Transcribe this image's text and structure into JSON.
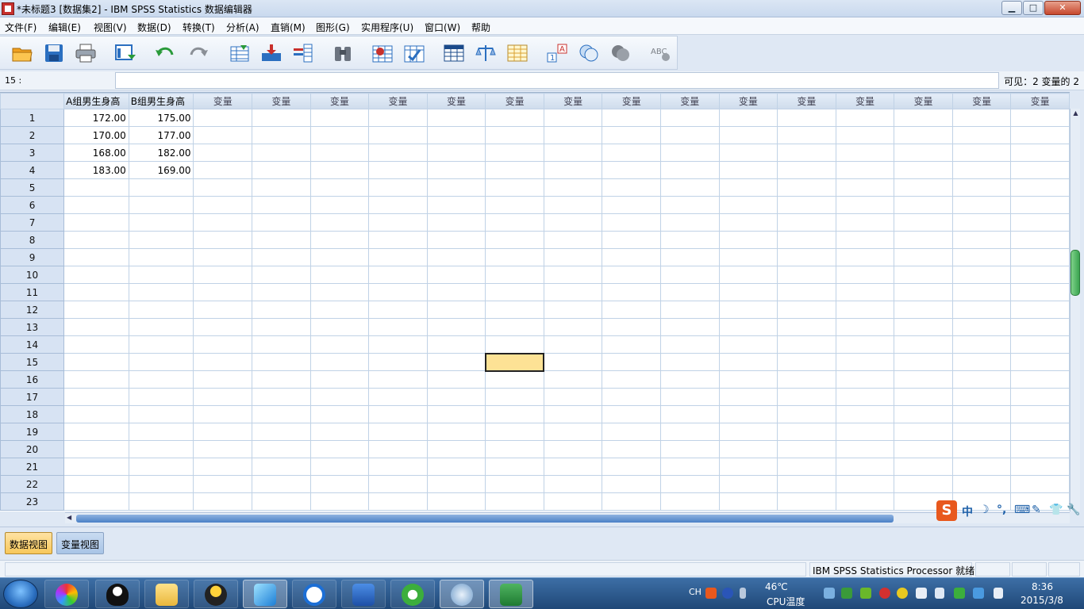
{
  "window": {
    "title": "*未标题3 [数据集2] - IBM SPSS Statistics 数据编辑器",
    "minimize": "▁",
    "maximize": "□",
    "close": "✕"
  },
  "menu": [
    "文件(F)",
    "编辑(E)",
    "视图(V)",
    "数据(D)",
    "转换(T)",
    "分析(A)",
    "直销(M)",
    "图形(G)",
    "实用程序(U)",
    "窗口(W)",
    "帮助"
  ],
  "toolbar": {
    "icons": [
      "open-folder-icon",
      "save-icon",
      "print-icon",
      "recall-dialog-icon",
      "undo-icon",
      "redo-icon",
      "goto-case-icon",
      "goto-variable-icon",
      "variables-icon",
      "find-icon",
      "insert-cases-icon",
      "insert-variable-icon",
      "split-file-icon",
      "weight-cases-icon",
      "select-cases-icon",
      "value-labels-icon",
      "use-variable-sets-icon",
      "show-all-variables-icon",
      "spell-check-icon"
    ],
    "colors": {
      "accent": "#2b6fc0",
      "orange": "#f0a020",
      "red": "#c8302c"
    }
  },
  "refbar": {
    "cell_ref": "15 :",
    "editor_value": "",
    "visible_info": "可见：2 变量的 2"
  },
  "grid": {
    "columns": [
      "A组男生身高",
      "B组男生身高",
      "变量",
      "变量",
      "变量",
      "变量",
      "变量",
      "变量",
      "变量",
      "变量",
      "变量",
      "变量",
      "变量",
      "变量",
      "变量",
      "变量",
      "变量"
    ],
    "row_numbers": [
      "1",
      "2",
      "3",
      "4",
      "5",
      "6",
      "7",
      "8",
      "9",
      "10",
      "11",
      "12",
      "13",
      "14",
      "15",
      "16",
      "17",
      "18",
      "19",
      "20",
      "21",
      "22",
      "23"
    ],
    "rows": [
      [
        "172.00",
        "175.00"
      ],
      [
        "170.00",
        "177.00"
      ],
      [
        "168.00",
        "182.00"
      ],
      [
        "183.00",
        "169.00"
      ]
    ],
    "active_cell": {
      "row": "15",
      "col": "变量"
    },
    "colors": {
      "active_fill": "#fde295",
      "header": "#cfdcec",
      "gridline": "#c0d2e6"
    }
  },
  "ime": {
    "logo": "S",
    "items": [
      "中",
      "☽",
      "°,",
      "⌨",
      "✎",
      "👕",
      "🔧"
    ]
  },
  "tabs": {
    "data_view": "数据视图",
    "variable_view": "变量视图"
  },
  "status": {
    "processor": "IBM SPSS Statistics Processor 就绪"
  },
  "taskbar": {
    "apps": [
      "start-orb-icon",
      "picasa-icon",
      "qq-icon",
      "explorer-folder-icon",
      "qq-friends-icon",
      "feiq-icon",
      "kuaibo-icon",
      "word-icon",
      "browser-icon",
      "mathtype-icon",
      "excel-icon"
    ],
    "tray": {
      "lang": "CH",
      "temperature": "46℃",
      "temperature_label": "CPU温度",
      "time": "8:36",
      "date": "2015/3/8"
    }
  }
}
